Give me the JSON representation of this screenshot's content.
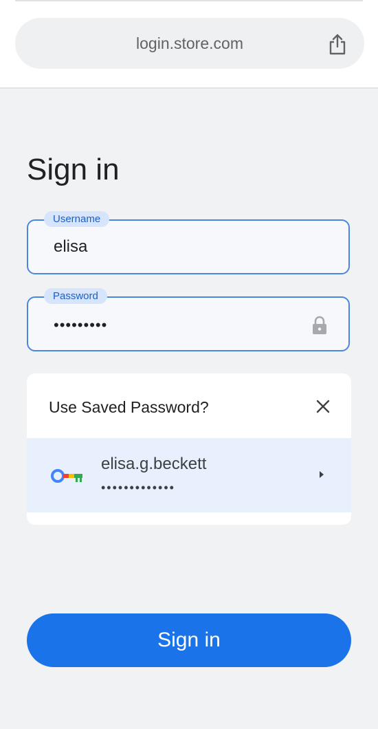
{
  "browser": {
    "url": "login.store.com",
    "share_icon": "share-icon"
  },
  "page": {
    "title": "Sign in"
  },
  "form": {
    "username": {
      "label": "Username",
      "value": "elisa"
    },
    "password": {
      "label": "Password",
      "value": "•••••••••",
      "lock_icon": "lock-icon"
    }
  },
  "saved_password_card": {
    "prompt": "Use Saved Password?",
    "close_icon": "close-icon",
    "account": {
      "key_icon": "key-icon",
      "username": "elisa.g.beckett",
      "masked_password": "•••••••••••••",
      "chevron_icon": "chevron-right-icon"
    }
  },
  "actions": {
    "sign_in_label": "Sign in",
    "primary_color": "#1a73e8"
  }
}
